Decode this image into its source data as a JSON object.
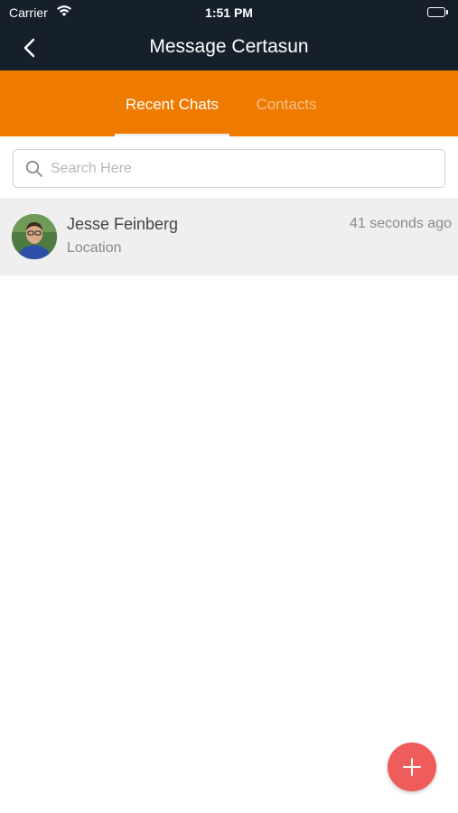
{
  "status_bar": {
    "carrier": "Carrier",
    "time": "1:51 PM"
  },
  "nav": {
    "title": "Message Certasun"
  },
  "tabs": [
    {
      "label": "Recent Chats",
      "active": true
    },
    {
      "label": "Contacts",
      "active": false
    }
  ],
  "search": {
    "placeholder": "Search Here",
    "value": ""
  },
  "chats": [
    {
      "name": "Jesse Feinberg",
      "preview": "Location",
      "time": "41 seconds ago"
    }
  ],
  "colors": {
    "header": "#15202b",
    "accent": "#ef7a00",
    "fab": "#ef5c5c"
  },
  "icons": [
    "wifi-icon",
    "battery-icon",
    "back-chevron-icon",
    "search-icon",
    "plus-icon"
  ]
}
